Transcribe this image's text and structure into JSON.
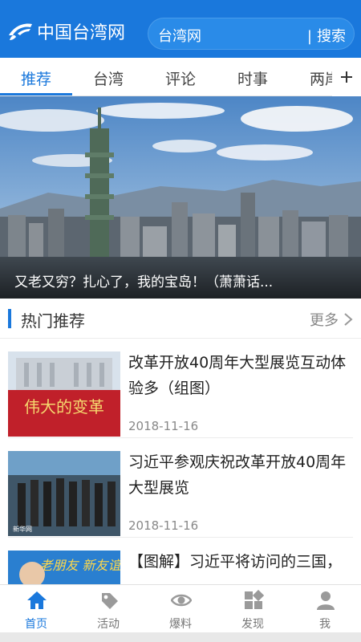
{
  "header": {
    "logo_text": "中国台湾网",
    "search_value": "台湾网",
    "search_button": "搜索"
  },
  "tabs": [
    {
      "label": "推荐",
      "active": true
    },
    {
      "label": "台湾",
      "active": false
    },
    {
      "label": "评论",
      "active": false
    },
    {
      "label": "时事",
      "active": false
    },
    {
      "label": "两岸",
      "active": false
    }
  ],
  "hero": {
    "caption": "又老又穷？扎心了，我的宝岛！（萧萧话..."
  },
  "section": {
    "title": "热门推荐",
    "more": "更多"
  },
  "news": [
    {
      "title": "改革开放40周年大型展览互动体验多（组图）",
      "date": "2018-11-16",
      "thumb_text": "伟大的变革"
    },
    {
      "title": "习近平参观庆祝改革开放40周年大型展览",
      "date": "2018-11-16",
      "thumb_text": "新华网"
    },
    {
      "title": "【图解】习近平将访问的三国，",
      "date": "",
      "thumb_text": "老朋友 新友谊"
    }
  ],
  "tabbar": [
    {
      "label": "首页",
      "icon": "home-icon",
      "active": true
    },
    {
      "label": "活动",
      "icon": "tag-icon",
      "active": false
    },
    {
      "label": "爆料",
      "icon": "eye-icon",
      "active": false
    },
    {
      "label": "发现",
      "icon": "grid-icon",
      "active": false
    },
    {
      "label": "我",
      "icon": "user-icon",
      "active": false
    }
  ],
  "colors": {
    "accent": "#1a78dc",
    "text": "#222222",
    "muted": "#888888"
  }
}
